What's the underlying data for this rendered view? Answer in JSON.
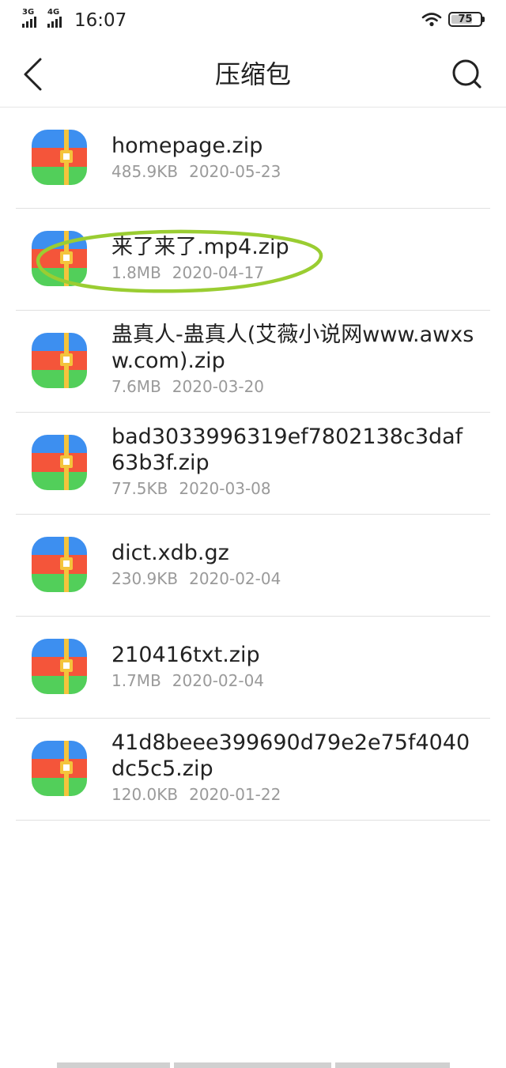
{
  "status_bar": {
    "network1": "3G",
    "network2": "4G",
    "time": "16:07",
    "battery": "75",
    "battery_level": 0.75
  },
  "header": {
    "title": "压缩包",
    "back_icon": "chevron-left-icon",
    "search_icon": "search-icon"
  },
  "files": [
    {
      "name": "homepage.zip",
      "size": "485.9KB",
      "date": "2020-05-23"
    },
    {
      "name": "来了来了.mp4.zip",
      "size": "1.8MB",
      "date": "2020-04-17"
    },
    {
      "name": "蛊真人-蛊真人(艾薇小说网www.awxsw.com).zip",
      "size": "7.6MB",
      "date": "2020-03-20"
    },
    {
      "name": "bad3033996319ef7802138c3daf63b3f.zip",
      "size": "77.5KB",
      "date": "2020-03-08"
    },
    {
      "name": "dict.xdb.gz",
      "size": "230.9KB",
      "date": "2020-02-04"
    },
    {
      "name": "210416txt.zip",
      "size": "1.7MB",
      "date": "2020-02-04"
    },
    {
      "name": "41d8beee399690d79e2e75f4040dc5c5.zip",
      "size": "120.0KB",
      "date": "2020-01-22"
    }
  ],
  "colors": {
    "icon_blue": "#3d8ff0",
    "icon_red": "#f4553a",
    "icon_green": "#52cf5a",
    "icon_zipper": "#f4c43c",
    "highlight_ellipse": "#9acd32",
    "meta_text": "#9a9a9a"
  }
}
